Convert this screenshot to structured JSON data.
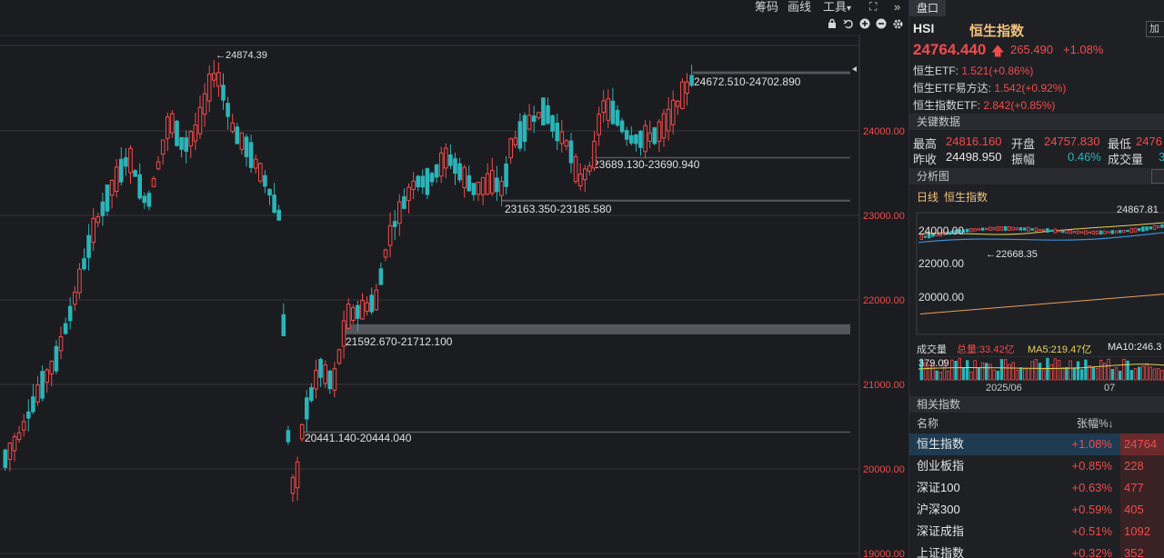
{
  "toolbar": {
    "chips": "筹码",
    "draw": "画线",
    "tools": "工具",
    "tools_arrow": "▾",
    "more": "»"
  },
  "icons": [
    "lock-icon",
    "undo-icon",
    "zoom-in-icon",
    "zoom-out-icon",
    "gear-icon",
    "expand-icon"
  ],
  "chart": {
    "price_axis": [
      "24000.00",
      "23000.00",
      "22000.00",
      "21000.00",
      "20000.00",
      "19000.00"
    ],
    "high_label": "←24874.39",
    "zones": [
      "24672.510-24702.890",
      "23689.130-23690.940",
      "23163.350-23185.580",
      "21592.670-21712.100",
      "20441.140-20444.040"
    ]
  },
  "panel": {
    "tab": "盘口",
    "code": "HSI",
    "name": "恒生指数",
    "add_btn": "加",
    "price": "24764.440",
    "change": "265.490",
    "change_pct": "+1.08%",
    "etfs": [
      {
        "label": "恒生ETF:",
        "value": "1.521(+0.86%)"
      },
      {
        "label": "恒生ETF易方达:",
        "value": "1.542(+0.92%)"
      },
      {
        "label": "恒生指数ETF:",
        "value": "2.842(+0.85%)"
      }
    ],
    "key_data_title": "关键数据",
    "kd": {
      "high_label": "最高",
      "high": "24816.160",
      "open_label": "开盘",
      "open": "24757.830",
      "low_label": "最低",
      "low": "2476",
      "prev_label": "昨收",
      "prev": "24498.950",
      "amp_label": "振幅",
      "amp": "0.46%",
      "vol_label": "成交量",
      "vol": "3"
    },
    "analysis_title": "分析图",
    "mini": {
      "period": "日线",
      "name": "恒生指数",
      "hi": "24867.81",
      "lo": "←22668.35",
      "y": [
        "24000.00",
        "22000.00",
        "20000.00"
      ],
      "vol_label": "成交量",
      "vol_total": "总量:33.42亿",
      "ma5": "MA5:219.47亿",
      "ma10": "MA10:246.3",
      "vol_axis": "379.09",
      "x": [
        "2025/06",
        "07"
      ]
    },
    "related_title": "相关指数",
    "related_cols": {
      "name": "名称",
      "pct": "张幅%↓"
    },
    "related": [
      {
        "name": "恒生指数",
        "pct": "+1.08%",
        "last": "24764"
      },
      {
        "name": "创业板指",
        "pct": "+0.85%",
        "last": "228"
      },
      {
        "name": "深证100",
        "pct": "+0.63%",
        "last": "477"
      },
      {
        "name": "沪深300",
        "pct": "+0.59%",
        "last": "405"
      },
      {
        "name": "深证成指",
        "pct": "+0.51%",
        "last": "1092"
      },
      {
        "name": "上证指数",
        "pct": "+0.32%",
        "last": "352"
      }
    ]
  },
  "colors": {
    "up": "#f24b4b",
    "down": "#2bb5b8",
    "bg": "#1b1c20"
  }
}
